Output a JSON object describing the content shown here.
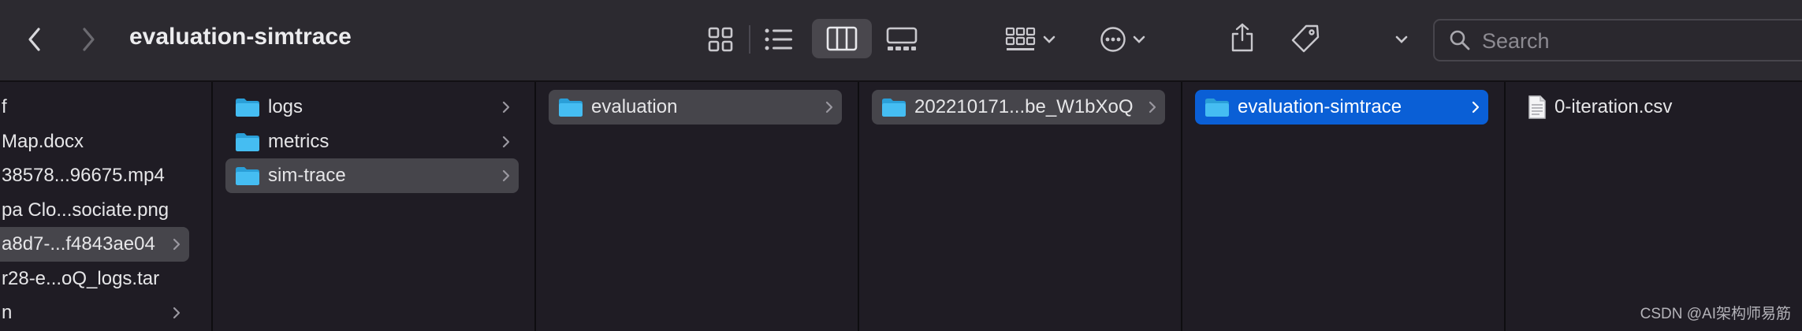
{
  "window": {
    "title": "evaluation-simtrace"
  },
  "toolbar": {
    "back_icon": "chevron-left-icon",
    "forward_icon": "chevron-right-icon",
    "views": [
      "icon-view-icon",
      "list-view-icon",
      "column-view-icon",
      "gallery-view-icon"
    ],
    "selected_view": "column-view-icon",
    "group_icon": "group-by-icon",
    "action_icon": "more-actions-icon",
    "share_icon": "share-icon",
    "tag_icon": "tag-icon",
    "expand_icon": "chevron-down-icon",
    "search": {
      "placeholder": "Search",
      "value": ""
    }
  },
  "columns": [
    {
      "items": [
        {
          "label": "f",
          "type": "file"
        },
        {
          "label": "Map.docx",
          "type": "file"
        },
        {
          "label": "38578...96675.mp4",
          "type": "file"
        },
        {
          "label": "pa Clo...sociate.png",
          "type": "file"
        },
        {
          "label": "a8d7-...f4843ae04",
          "type": "folder",
          "selected": true,
          "chevron": true
        },
        {
          "label": "r28-e...oQ_logs.tar",
          "type": "file"
        },
        {
          "label": "n",
          "type": "folder",
          "chevron": true
        }
      ]
    },
    {
      "items": [
        {
          "label": "logs",
          "type": "folder",
          "chevron": true
        },
        {
          "label": "metrics",
          "type": "folder",
          "chevron": true
        },
        {
          "label": "sim-trace",
          "type": "folder",
          "chevron": true,
          "selected": true
        }
      ]
    },
    {
      "items": [
        {
          "label": "evaluation",
          "type": "folder",
          "chevron": true,
          "selected": true
        }
      ]
    },
    {
      "items": [
        {
          "label": "202210171...be_W1bXoQ",
          "type": "folder",
          "chevron": true,
          "selected": true
        }
      ]
    },
    {
      "items": [
        {
          "label": "evaluation-simtrace",
          "type": "folder",
          "chevron": true,
          "active": true
        }
      ]
    },
    {
      "items": [
        {
          "label": "0-iteration.csv",
          "type": "document"
        }
      ]
    }
  ],
  "watermark": "CSDN @AI架构师易筋",
  "colors": {
    "accent": "#0a5fd6",
    "folder": "#3fb6ee",
    "background": "#1f1c24",
    "toolbar": "#2c2a30"
  }
}
